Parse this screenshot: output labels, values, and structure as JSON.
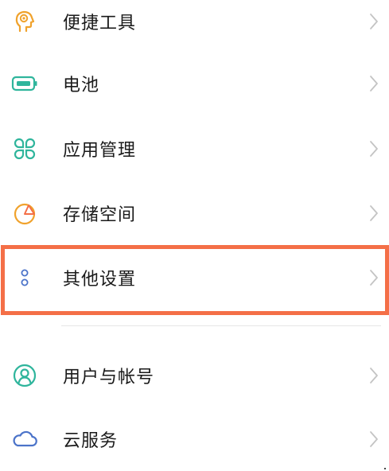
{
  "settings": {
    "items": [
      {
        "label": "便捷工具",
        "icon": "convenience-tools-icon"
      },
      {
        "label": "电池",
        "icon": "battery-icon"
      },
      {
        "label": "应用管理",
        "icon": "app-management-icon"
      },
      {
        "label": "存储空间",
        "icon": "storage-icon"
      },
      {
        "label": "其他设置",
        "icon": "more-settings-icon"
      },
      {
        "label": "用户与帐号",
        "icon": "user-account-icon"
      },
      {
        "label": "云服务",
        "icon": "cloud-icon"
      }
    ]
  },
  "colors": {
    "highlight_border": "#f46f47",
    "orange_icon": "#f0a22c",
    "green_icon": "#2fb59c",
    "blue_icon": "#4b73c9",
    "chevron": "#c4c4c4"
  }
}
